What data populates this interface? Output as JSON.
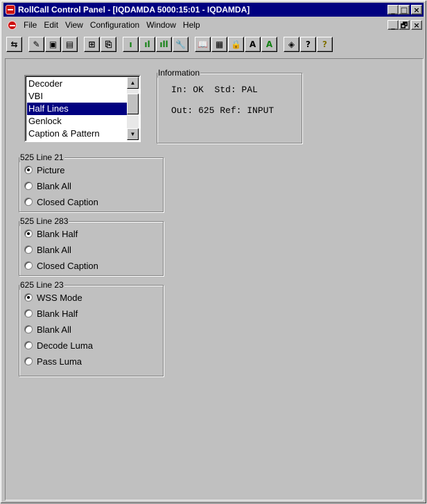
{
  "window": {
    "title": "RollCall Control Panel - [IQDAMDA 5000:15:01 - IQDAMDA]",
    "controls": {
      "minimize": "_",
      "maximize": "□",
      "close": "×"
    },
    "mdi_controls": {
      "minimize": "_",
      "restore": "🗗",
      "close": "×"
    }
  },
  "menu": {
    "items": [
      {
        "label": "File"
      },
      {
        "label": "Edit"
      },
      {
        "label": "View"
      },
      {
        "label": "Configuration"
      },
      {
        "label": "Window"
      },
      {
        "label": "Help"
      }
    ]
  },
  "toolbar": {
    "glyphs": {
      "connect": "⇆",
      "edit": "✎",
      "save": "▣",
      "save_as": "▤",
      "network": "⊞",
      "device": "⎘",
      "bars_small": "ı",
      "bars_medium": "ıl",
      "bars_large": "ıll",
      "wrench": "🔧",
      "book": "📖",
      "notepad": "▦",
      "lock": "🔒",
      "font_a": "A",
      "font_a_green": "A",
      "eraser": "◈",
      "help_index": "?",
      "help": "?"
    }
  },
  "list": {
    "items": [
      "Decoder",
      "VBI",
      "Half Lines",
      "Genlock",
      "Caption & Pattern"
    ],
    "selected": "Half Lines",
    "scroll_up": "▲",
    "scroll_down": "▼"
  },
  "information": {
    "title": "Information",
    "line1": "In: OK  Std: PAL",
    "line2": "Out: 625 Ref: INPUT"
  },
  "groups": {
    "line21": {
      "title": "525 Line 21",
      "options": [
        "Picture",
        "Blank All",
        "Closed Caption"
      ],
      "selected": 0
    },
    "line283": {
      "title": "525 Line 283",
      "options": [
        "Blank Half",
        "Blank All",
        "Closed Caption"
      ],
      "selected": 0
    },
    "line23": {
      "title": "625 Line 23",
      "options": [
        "WSS Mode",
        "Blank Half",
        "Blank All",
        "Decode Luma",
        "Pass Luma"
      ],
      "selected": 0
    }
  },
  "colors": {
    "title_bar": "#000080",
    "selection": "#000080",
    "face": "#c0c0c0"
  }
}
